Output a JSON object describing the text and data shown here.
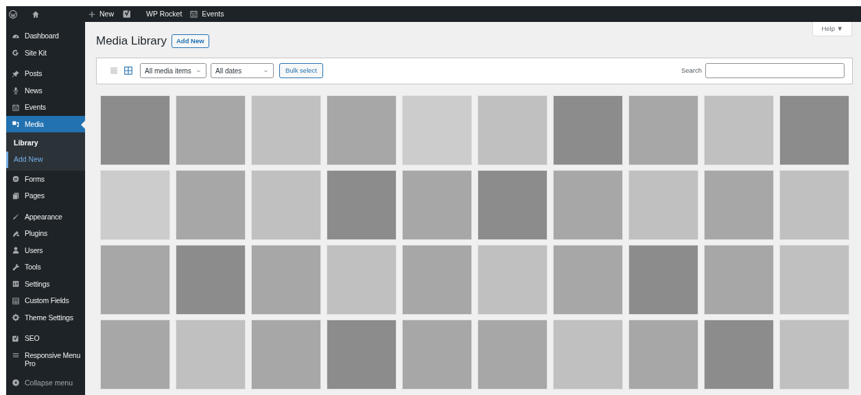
{
  "admin_bar": {
    "items": [
      {
        "label": "New"
      },
      {
        "label": "WP Rocket"
      },
      {
        "label": "Events"
      }
    ]
  },
  "sidebar": {
    "sections": [
      {
        "items": [
          {
            "label": "Dashboard",
            "selected": false
          },
          {
            "label": "Site Kit",
            "selected": false
          }
        ]
      },
      {
        "items": [
          {
            "label": "Posts",
            "selected": false
          },
          {
            "label": "News",
            "selected": false
          },
          {
            "label": "Events",
            "selected": false
          },
          {
            "label": "Media",
            "selected": true,
            "children": [
              {
                "label": "Library",
                "selected": true,
                "highlighted": false
              },
              {
                "label": "Add New",
                "selected": false,
                "highlighted": true
              }
            ]
          },
          {
            "label": "Forms",
            "selected": false
          },
          {
            "label": "Pages",
            "selected": false
          }
        ]
      },
      {
        "items": [
          {
            "label": "Appearance",
            "selected": false
          },
          {
            "label": "Plugins",
            "selected": false
          },
          {
            "label": "Users",
            "selected": false
          },
          {
            "label": "Tools",
            "selected": false
          },
          {
            "label": "Settings",
            "selected": false
          },
          {
            "label": "Custom Fields",
            "selected": false
          },
          {
            "label": "Theme Settings",
            "selected": false
          }
        ]
      },
      {
        "items": [
          {
            "label": "SEO",
            "selected": false
          },
          {
            "label": "Responsive Menu Pro",
            "selected": false
          }
        ]
      }
    ],
    "collapse": "Collapse menu"
  },
  "page": {
    "title": "Media Library",
    "add_new": "Add New",
    "help": "Help ▼"
  },
  "toolbar": {
    "view_modes": [
      {
        "selected": false
      },
      {
        "selected": true
      }
    ],
    "type_filter": "All media items",
    "date_filter": "All dates",
    "bulk_select": "Bulk select",
    "search_label": "Search"
  },
  "media": [
    {
      "color": "#8c8c8c"
    },
    {
      "color": "#a7a7a7"
    },
    {
      "color": "#c0c0c0"
    },
    {
      "color": "#a7a7a7"
    },
    {
      "color": "#cccccc"
    },
    {
      "color": "#c0c0c0"
    },
    {
      "color": "#8c8c8c"
    },
    {
      "color": "#a7a7a7"
    },
    {
      "color": "#c0c0c0"
    },
    {
      "color": "#8c8c8c"
    },
    {
      "color": "#cccccc"
    },
    {
      "color": "#a7a7a7"
    },
    {
      "color": "#c0c0c0"
    },
    {
      "color": "#8c8c8c"
    },
    {
      "color": "#a7a7a7"
    },
    {
      "color": "#8c8c8c"
    },
    {
      "color": "#a7a7a7"
    },
    {
      "color": "#c0c0c0"
    },
    {
      "color": "#a7a7a7"
    },
    {
      "color": "#c0c0c0"
    },
    {
      "color": "#a7a7a7"
    },
    {
      "color": "#8c8c8c"
    },
    {
      "color": "#a7a7a7"
    },
    {
      "color": "#c0c0c0"
    },
    {
      "color": "#a7a7a7"
    },
    {
      "color": "#c0c0c0"
    },
    {
      "color": "#a7a7a7"
    },
    {
      "color": "#8c8c8c"
    },
    {
      "color": "#a7a7a7"
    },
    {
      "color": "#c0c0c0"
    },
    {
      "color": "#a7a7a7"
    },
    {
      "color": "#c0c0c0"
    },
    {
      "color": "#a7a7a7"
    },
    {
      "color": "#8c8c8c"
    },
    {
      "color": "#a7a7a7"
    },
    {
      "color": "#a7a7a7"
    },
    {
      "color": "#c0c0c0"
    },
    {
      "color": "#a7a7a7"
    },
    {
      "color": "#8c8c8c"
    },
    {
      "color": "#c0c0c0"
    }
  ]
}
